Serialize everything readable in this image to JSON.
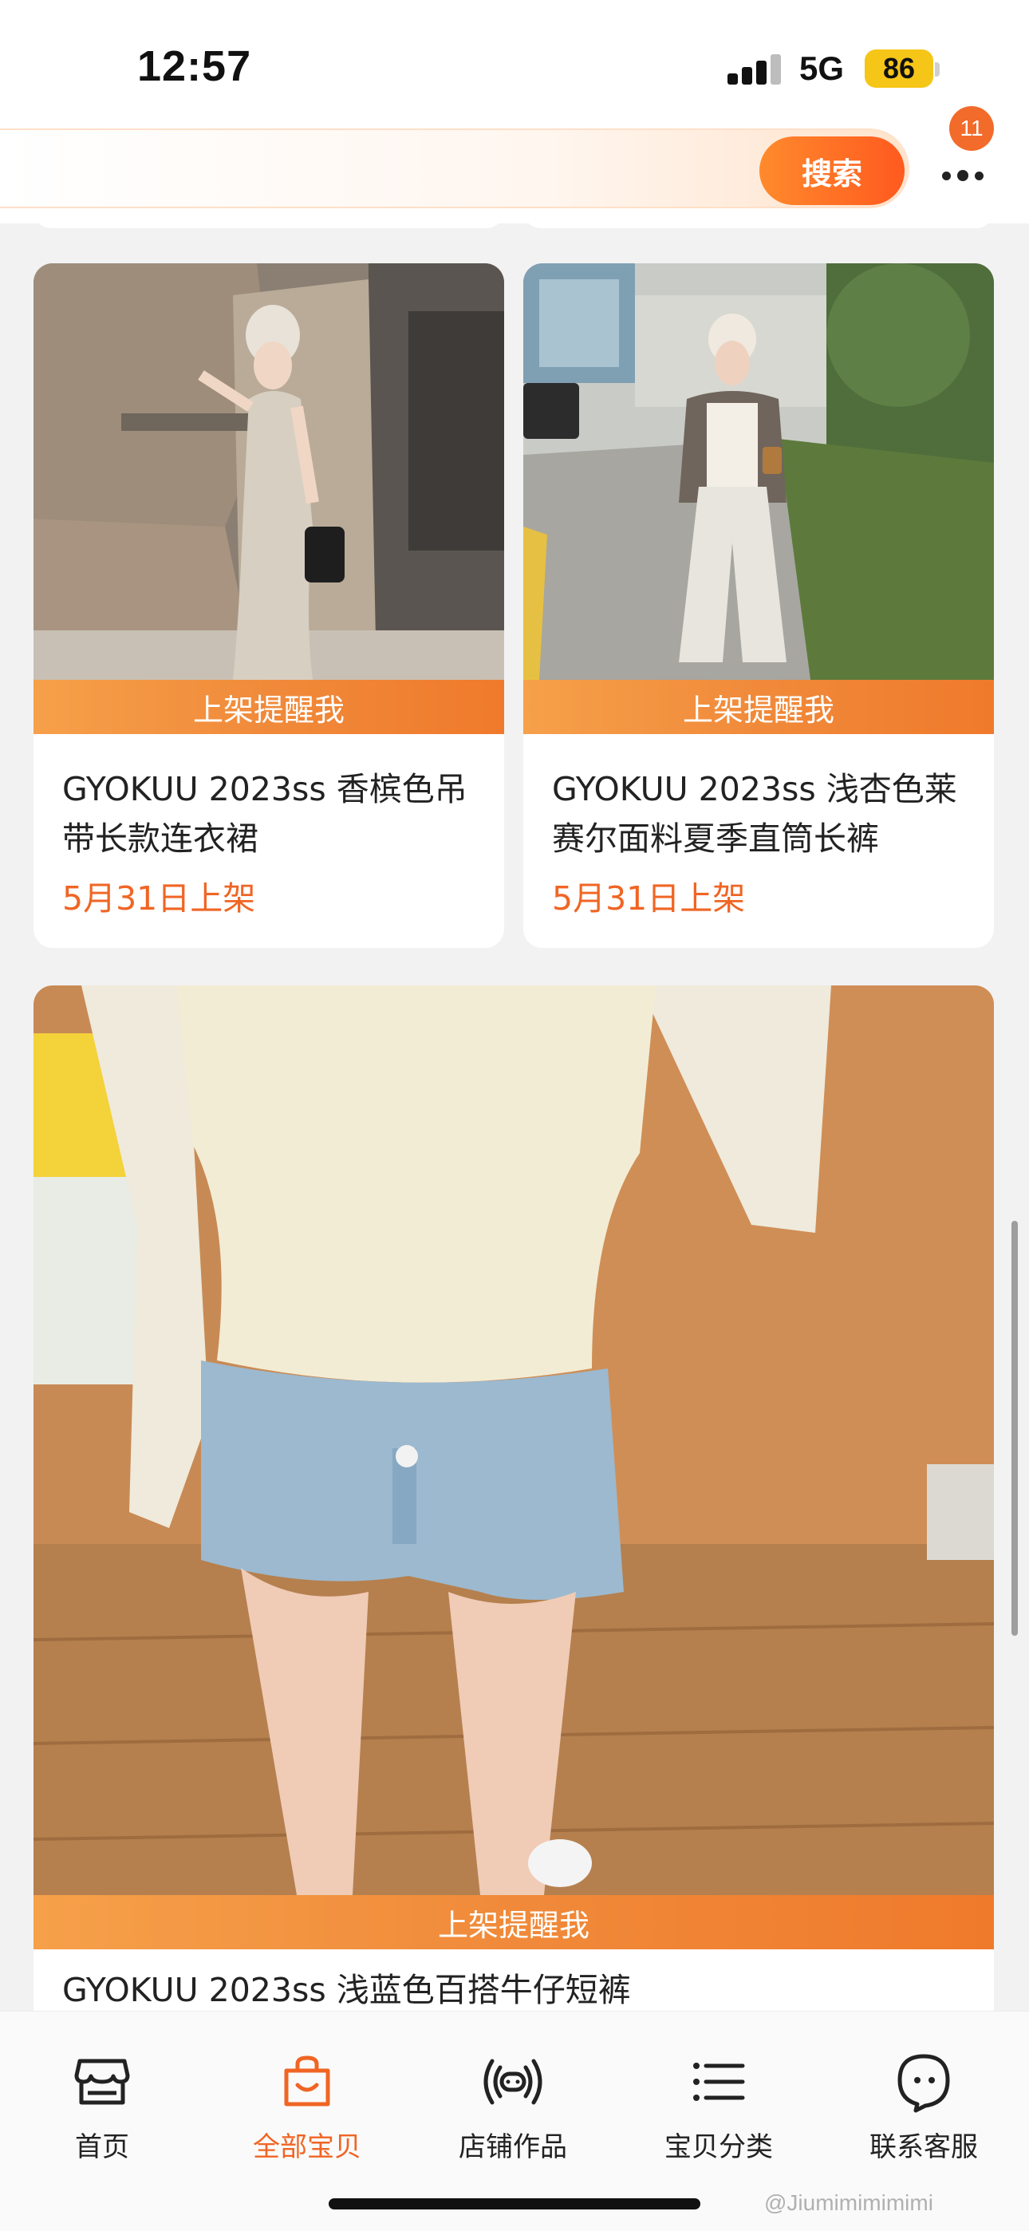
{
  "status_bar": {
    "time": "12:57",
    "network": "5G",
    "battery": "86"
  },
  "search": {
    "placeholder": "",
    "button_label": "搜索",
    "notification_count": "11"
  },
  "products": [
    {
      "title": "GYOKUU 2023ss 香槟色吊带长款连衣裙",
      "remind_label": "上架提醒我",
      "date": "5月31日上架"
    },
    {
      "title": "GYOKUU 2023ss 浅杏色莱赛尔面料夏季直筒长裤",
      "remind_label": "上架提醒我",
      "date": "5月31日上架"
    },
    {
      "title": "GYOKUU 2023ss 浅蓝色百搭牛仔短裤",
      "remind_label": "上架提醒我",
      "date": ""
    }
  ],
  "bottom_nav": [
    {
      "label": "首页",
      "icon": "store-icon"
    },
    {
      "label": "全部宝贝",
      "icon": "shopping-bag-icon",
      "active": true
    },
    {
      "label": "店铺作品",
      "icon": "broadcast-icon"
    },
    {
      "label": "宝贝分类",
      "icon": "list-icon"
    },
    {
      "label": "联系客服",
      "icon": "chat-face-icon"
    }
  ],
  "watermark": "@Jiumimimimimi",
  "colors": {
    "accent": "#f06524",
    "search_button": "#ff6a24",
    "remind_bar": "#f08a3a",
    "battery": "#f5c518"
  }
}
